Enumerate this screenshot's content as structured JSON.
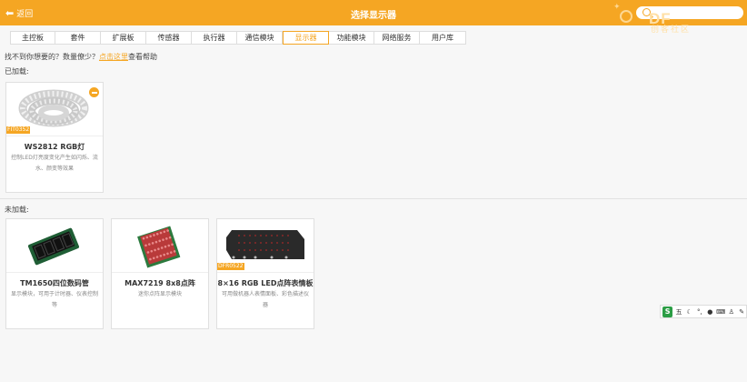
{
  "header": {
    "back_label": "返回",
    "title": "选择显示器",
    "search_placeholder": "",
    "logo_text": "DF",
    "logo_sub": "创客社区",
    "accent": "#f5a623"
  },
  "tabs": [
    {
      "label": "主控板"
    },
    {
      "label": "套件"
    },
    {
      "label": "扩展板"
    },
    {
      "label": "传感器"
    },
    {
      "label": "执行器"
    },
    {
      "label": "通信模块"
    },
    {
      "label": "显示器",
      "active": true
    },
    {
      "label": "功能模块"
    },
    {
      "label": "网络服务"
    },
    {
      "label": "用户库"
    }
  ],
  "hint": {
    "prefix": "找不到你想要的？数量僚少？",
    "link": "点击这里",
    "suffix": "查看帮助"
  },
  "loaded": {
    "label": "已加载:",
    "items": [
      {
        "sku": "FIT0352",
        "name": "WS2812 RGB灯",
        "desc": "控制LED灯亮度变化产生如闪烁、流水、颜变等效果",
        "icon": "led-strip-icon"
      }
    ]
  },
  "unloaded": {
    "label": "未加载:",
    "items": [
      {
        "sku": "",
        "name": "TM1650四位数码管",
        "desc": "显示模块，可用于计时器、仪表控制等",
        "icon": "seven-segment-display-icon"
      },
      {
        "sku": "",
        "name": "MAX7219 8x8点阵",
        "desc": "迷你点阵显示模块",
        "icon": "dot-matrix-icon"
      },
      {
        "sku": "DFR0522",
        "name": "8×16 RGB LED点阵表情板",
        "desc": "可用做机器人表情面板、彩色描述仪器",
        "icon": "rgb-matrix-panel-icon"
      }
    ]
  },
  "ime": {
    "logo": "S",
    "mode": "五"
  }
}
